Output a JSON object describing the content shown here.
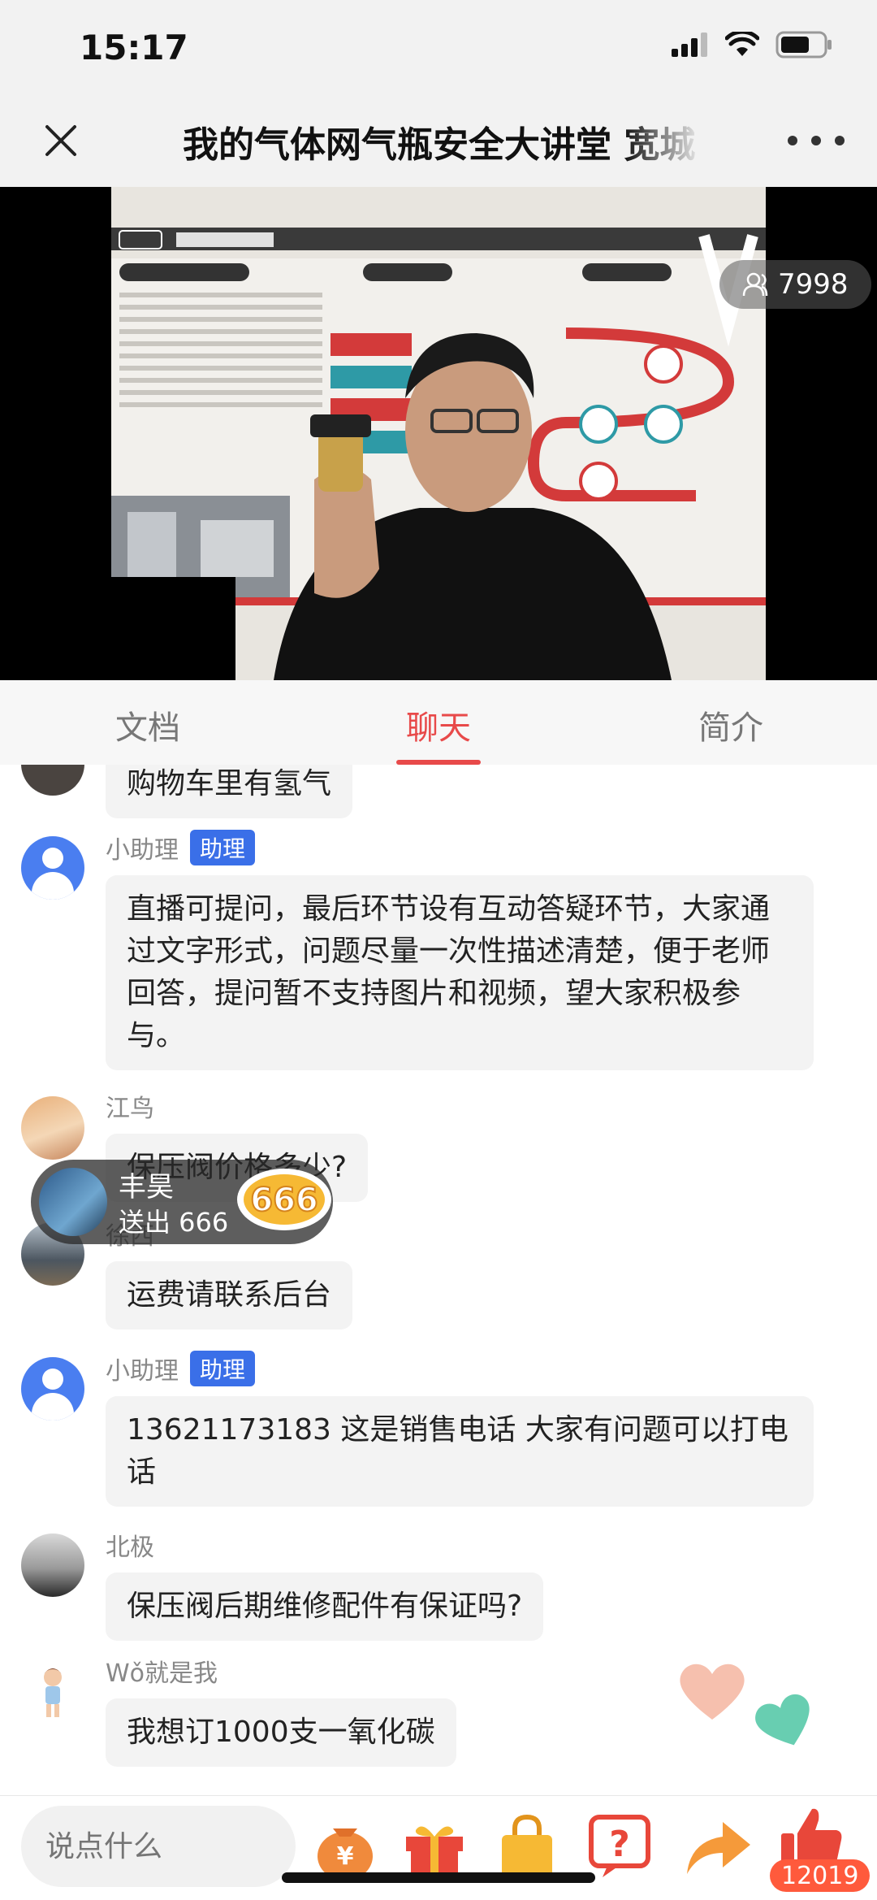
{
  "status_bar": {
    "time": "15:17"
  },
  "header": {
    "title": "我的气体网气瓶安全大讲堂 宽城"
  },
  "video": {
    "viewer_count": "7998"
  },
  "tabs": [
    {
      "label": "文档",
      "active": false
    },
    {
      "label": "聊天",
      "active": true
    },
    {
      "label": "简介",
      "active": false
    }
  ],
  "chat": {
    "messages": [
      {
        "user": "",
        "text": "购物车里有氢气"
      },
      {
        "user": "小助理",
        "badge": "助理",
        "text": "直播可提问，最后环节设有互动答疑环节，大家通过文字形式，问题尽量一次性描述清楚，便于老师回答，提问暂不支持图片和视频，望大家积极参与。"
      },
      {
        "user": "江鸟",
        "text": "保压阀价格多少?"
      },
      {
        "user": "徐西",
        "text": "运费请联系后台"
      },
      {
        "user": "小助理",
        "badge": "助理",
        "text": "13621173183 这是销售电话 大家有问题可以打电话"
      },
      {
        "user": "北极",
        "text": "保压阀后期维修配件有保证吗?"
      },
      {
        "user": "Wǒ就是我",
        "text": "我想订1000支一氧化碳"
      }
    ]
  },
  "gift_popup": {
    "user": "丰昊",
    "action": "送出 666",
    "gift": "666"
  },
  "bottom_bar": {
    "input_placeholder": "说点什么",
    "like_count": "12019",
    "icons": [
      "money-bag-icon",
      "gift-box-icon",
      "shopping-bag-icon",
      "question-icon",
      "share-icon",
      "thumbs-up-icon"
    ]
  },
  "colors": {
    "accent": "#e84a4a",
    "badge": "#3a6fe8",
    "like": "#ff5a3c"
  }
}
